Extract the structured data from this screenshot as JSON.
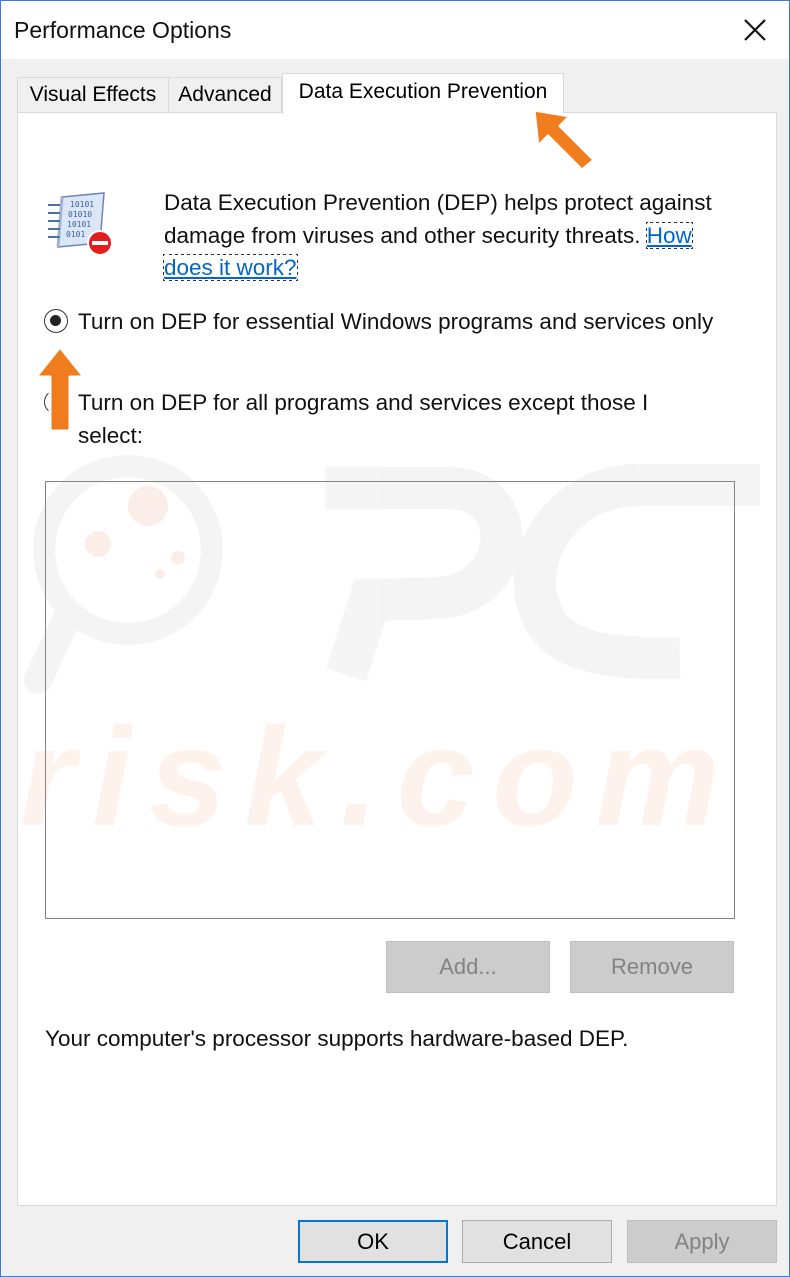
{
  "window": {
    "title": "Performance Options"
  },
  "tabs": [
    {
      "label": "Visual Effects"
    },
    {
      "label": "Advanced"
    },
    {
      "label": "Data Execution Prevention",
      "active": true
    }
  ],
  "dep": {
    "description": "Data Execution Prevention (DEP) helps protect against damage from viruses and other security threats.",
    "link_text": "How does it work?",
    "options": [
      {
        "label": "Turn on DEP for essential Windows programs and services only",
        "selected": true
      },
      {
        "label": "Turn on DEP for all programs and services except those I select:",
        "selected": false
      }
    ],
    "add_label": "Add...",
    "remove_label": "Remove",
    "support_text": "Your computer's processor supports hardware-based DEP."
  },
  "footer": {
    "ok": "OK",
    "cancel": "Cancel",
    "apply": "Apply"
  },
  "watermark": {
    "brand": "risk.com"
  },
  "colors": {
    "accent": "#0078d7",
    "annotation_arrow": "#f07c1d",
    "link": "#0066cc"
  },
  "icons": [
    "close-icon",
    "dep-binary-icon",
    "no-entry-icon",
    "radio-selected",
    "arrow-annotation"
  ]
}
